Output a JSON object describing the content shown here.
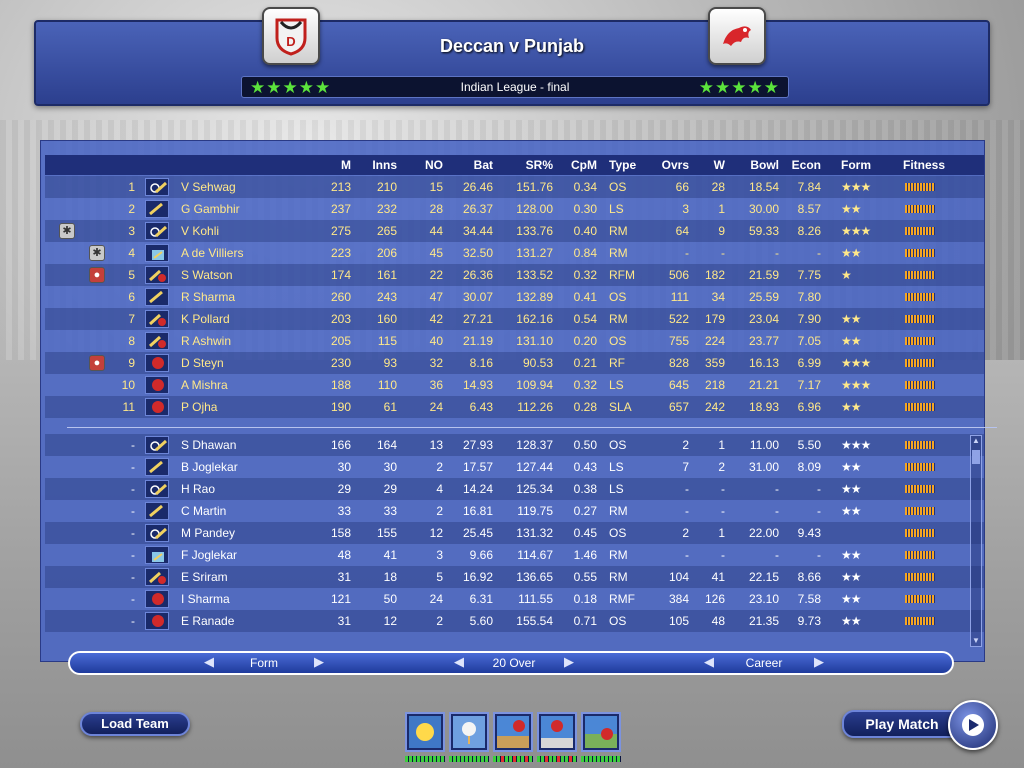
{
  "match": {
    "title": "Deccan v Punjab",
    "subtitle": "Indian League - final",
    "home_stars": "★★★★★",
    "away_stars": "★★★★★",
    "home_team_icon": "deccan-crest-icon",
    "away_team_icon": "punjab-lion-icon",
    "accent_color": "#5be33c"
  },
  "columns": {
    "m": "M",
    "inns": "Inns",
    "no": "NO",
    "bat": "Bat",
    "sr": "SR%",
    "cpm": "CpM",
    "type": "Type",
    "ovrs": "Ovrs",
    "w": "W",
    "bowl": "Bowl",
    "econ": "Econ",
    "form": "Form",
    "fitness": "Fitness"
  },
  "xi": [
    {
      "n": "1",
      "name": "V Sehwag",
      "m": "213",
      "inns": "210",
      "no": "15",
      "bat": "26.46",
      "sr": "151.76",
      "cpm": "0.34",
      "type": "OS",
      "ovrs": "66",
      "w": "28",
      "bowl": "18.54",
      "econ": "7.84",
      "form": "★★★"
    },
    {
      "n": "2",
      "name": "G Gambhir",
      "m": "237",
      "inns": "232",
      "no": "28",
      "bat": "26.37",
      "sr": "128.00",
      "cpm": "0.30",
      "type": "LS",
      "ovrs": "3",
      "w": "1",
      "bowl": "30.00",
      "econ": "8.57",
      "form": "★★"
    },
    {
      "n": "3",
      "name": "V Kohli",
      "m": "275",
      "inns": "265",
      "no": "44",
      "bat": "34.44",
      "sr": "133.76",
      "cpm": "0.40",
      "type": "RM",
      "ovrs": "64",
      "w": "9",
      "bowl": "59.33",
      "econ": "8.26",
      "form": "★★★"
    },
    {
      "n": "4",
      "name": "A de Villiers",
      "m": "223",
      "inns": "206",
      "no": "45",
      "bat": "32.50",
      "sr": "131.27",
      "cpm": "0.84",
      "type": "RM",
      "ovrs": "-",
      "w": "-",
      "bowl": "-",
      "econ": "-",
      "form": "★★"
    },
    {
      "n": "5",
      "name": "S Watson",
      "m": "174",
      "inns": "161",
      "no": "22",
      "bat": "26.36",
      "sr": "133.52",
      "cpm": "0.32",
      "type": "RFM",
      "ovrs": "506",
      "w": "182",
      "bowl": "21.59",
      "econ": "7.75",
      "form": "★"
    },
    {
      "n": "6",
      "name": "R Sharma",
      "m": "260",
      "inns": "243",
      "no": "47",
      "bat": "30.07",
      "sr": "132.89",
      "cpm": "0.41",
      "type": "OS",
      "ovrs": "111",
      "w": "34",
      "bowl": "25.59",
      "econ": "7.80",
      "form": ""
    },
    {
      "n": "7",
      "name": "K Pollard",
      "m": "203",
      "inns": "160",
      "no": "42",
      "bat": "27.21",
      "sr": "162.16",
      "cpm": "0.54",
      "type": "RM",
      "ovrs": "522",
      "w": "179",
      "bowl": "23.04",
      "econ": "7.90",
      "form": "★★"
    },
    {
      "n": "8",
      "name": "R Ashwin",
      "m": "205",
      "inns": "115",
      "no": "40",
      "bat": "21.19",
      "sr": "131.10",
      "cpm": "0.20",
      "type": "OS",
      "ovrs": "755",
      "w": "224",
      "bowl": "23.77",
      "econ": "7.05",
      "form": "★★"
    },
    {
      "n": "9",
      "name": "D Steyn",
      "m": "230",
      "inns": "93",
      "no": "32",
      "bat": "8.16",
      "sr": "90.53",
      "cpm": "0.21",
      "type": "RF",
      "ovrs": "828",
      "w": "359",
      "bowl": "16.13",
      "econ": "6.99",
      "form": "★★★"
    },
    {
      "n": "10",
      "name": "A Mishra",
      "m": "188",
      "inns": "110",
      "no": "36",
      "bat": "14.93",
      "sr": "109.94",
      "cpm": "0.32",
      "type": "LS",
      "ovrs": "645",
      "w": "218",
      "bowl": "21.21",
      "econ": "7.17",
      "form": "★★★"
    },
    {
      "n": "11",
      "name": "P Ojha",
      "m": "190",
      "inns": "61",
      "no": "24",
      "bat": "6.43",
      "sr": "112.26",
      "cpm": "0.28",
      "type": "SLA",
      "ovrs": "657",
      "w": "242",
      "bowl": "18.93",
      "econ": "6.96",
      "form": "★★"
    }
  ],
  "squad": [
    {
      "n": "-",
      "name": "S Dhawan",
      "m": "166",
      "inns": "164",
      "no": "13",
      "bat": "27.93",
      "sr": "128.37",
      "cpm": "0.50",
      "type": "OS",
      "ovrs": "2",
      "w": "1",
      "bowl": "11.00",
      "econ": "5.50",
      "form": "★★★"
    },
    {
      "n": "-",
      "name": "B Joglekar",
      "m": "30",
      "inns": "30",
      "no": "2",
      "bat": "17.57",
      "sr": "127.44",
      "cpm": "0.43",
      "type": "LS",
      "ovrs": "7",
      "w": "2",
      "bowl": "31.00",
      "econ": "8.09",
      "form": "★★"
    },
    {
      "n": "-",
      "name": "H Rao",
      "m": "29",
      "inns": "29",
      "no": "4",
      "bat": "14.24",
      "sr": "125.34",
      "cpm": "0.38",
      "type": "LS",
      "ovrs": "-",
      "w": "-",
      "bowl": "-",
      "econ": "-",
      "form": "★★"
    },
    {
      "n": "-",
      "name": "C Martin",
      "m": "33",
      "inns": "33",
      "no": "2",
      "bat": "16.81",
      "sr": "119.75",
      "cpm": "0.27",
      "type": "RM",
      "ovrs": "-",
      "w": "-",
      "bowl": "-",
      "econ": "-",
      "form": "★★"
    },
    {
      "n": "-",
      "name": "M Pandey",
      "m": "158",
      "inns": "155",
      "no": "12",
      "bat": "25.45",
      "sr": "131.32",
      "cpm": "0.45",
      "type": "OS",
      "ovrs": "2",
      "w": "1",
      "bowl": "22.00",
      "econ": "9.43",
      "form": ""
    },
    {
      "n": "-",
      "name": "F Joglekar",
      "m": "48",
      "inns": "41",
      "no": "3",
      "bat": "9.66",
      "sr": "114.67",
      "cpm": "1.46",
      "type": "RM",
      "ovrs": "-",
      "w": "-",
      "bowl": "-",
      "econ": "-",
      "form": "★★"
    },
    {
      "n": "-",
      "name": "E Sriram",
      "m": "31",
      "inns": "18",
      "no": "5",
      "bat": "16.92",
      "sr": "136.65",
      "cpm": "0.55",
      "type": "RM",
      "ovrs": "104",
      "w": "41",
      "bowl": "22.15",
      "econ": "8.66",
      "form": "★★"
    },
    {
      "n": "-",
      "name": "I Sharma",
      "m": "121",
      "inns": "50",
      "no": "24",
      "bat": "6.31",
      "sr": "111.55",
      "cpm": "0.18",
      "type": "RMF",
      "ovrs": "384",
      "w": "126",
      "bowl": "23.10",
      "econ": "7.58",
      "form": "★★"
    },
    {
      "n": "-",
      "name": "E Ranade",
      "m": "31",
      "inns": "12",
      "no": "2",
      "bat": "5.60",
      "sr": "155.54",
      "cpm": "0.71",
      "type": "OS",
      "ovrs": "105",
      "w": "48",
      "bowl": "21.35",
      "econ": "9.73",
      "form": "★★"
    }
  ],
  "selectors": {
    "stat_view": "Form",
    "format": "20 Over",
    "period": "Career"
  },
  "buttons": {
    "load_team": "Load Team",
    "play_match": "Play Match"
  },
  "conditions": [
    "sun-weather-icon",
    "golf-ball-pitch-icon",
    "ball-pitch-bounce-icon",
    "ball-swing-icon",
    "ball-seam-icon"
  ]
}
